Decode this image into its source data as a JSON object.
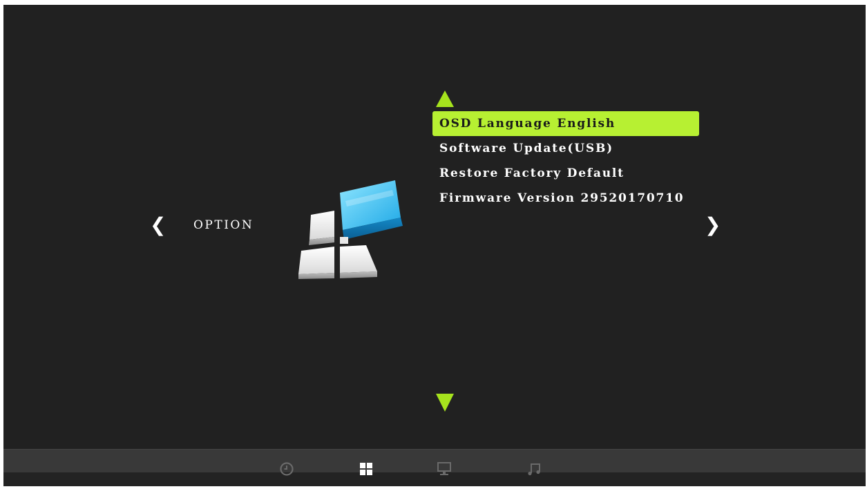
{
  "category": {
    "label": "OPTION",
    "prev_icon": "chevron-left-icon",
    "next_icon": "chevron-right-icon",
    "prev_glyph": "❮",
    "next_glyph": "❯"
  },
  "menu": {
    "items": [
      {
        "label": "OSD Language English",
        "selected": true
      },
      {
        "label": "Software Update(USB)",
        "selected": false
      },
      {
        "label": "Restore Factory Default",
        "selected": false
      },
      {
        "label": "Firmware Version 29520170710",
        "selected": false
      }
    ],
    "scroll_up_icon": "triangle-up-icon",
    "scroll_down_icon": "triangle-down-icon"
  },
  "bottom_tabs": [
    {
      "icon": "clock-icon",
      "active": false
    },
    {
      "icon": "grid-icon",
      "active": true
    },
    {
      "icon": "monitor-icon",
      "active": false
    },
    {
      "icon": "music-note-icon",
      "active": false
    }
  ],
  "colors": {
    "background": "#212121",
    "accent": "#b7f032",
    "arrow": "#a6e31d",
    "text": "#ffffff",
    "bar": "#393939",
    "tab_inactive": "#6a6a6a",
    "tab_active": "#ffffff"
  }
}
